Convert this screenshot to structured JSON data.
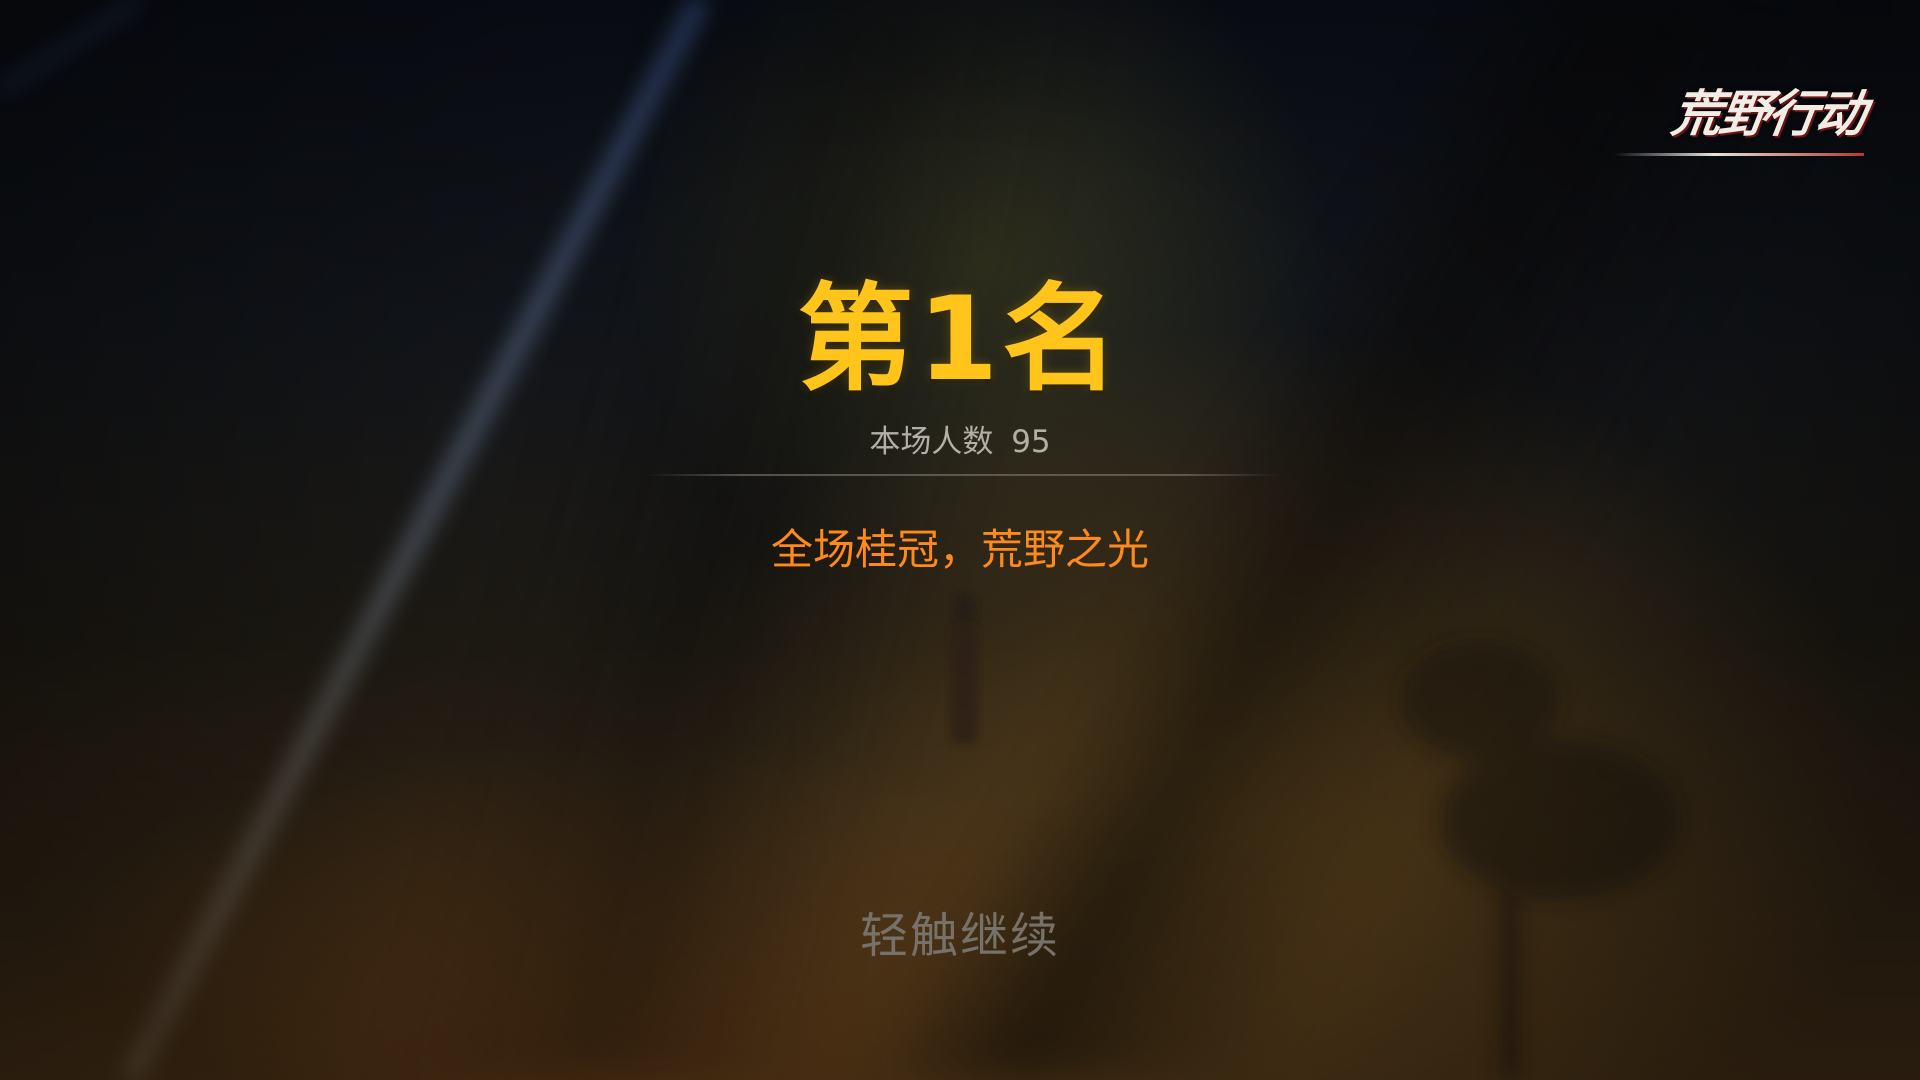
{
  "logo": {
    "text": "荒野行动"
  },
  "result": {
    "rank_label": "第1名",
    "player_count_label": "本场人数",
    "player_count": "95",
    "motto": "全场桂冠，荒野之光"
  },
  "prompt": {
    "tap_to_continue": "轻触继续"
  },
  "colors": {
    "rank": "#ffc51a",
    "motto": "#ff8a1c",
    "player_count": "#b3aea6",
    "prompt": "#767169"
  }
}
